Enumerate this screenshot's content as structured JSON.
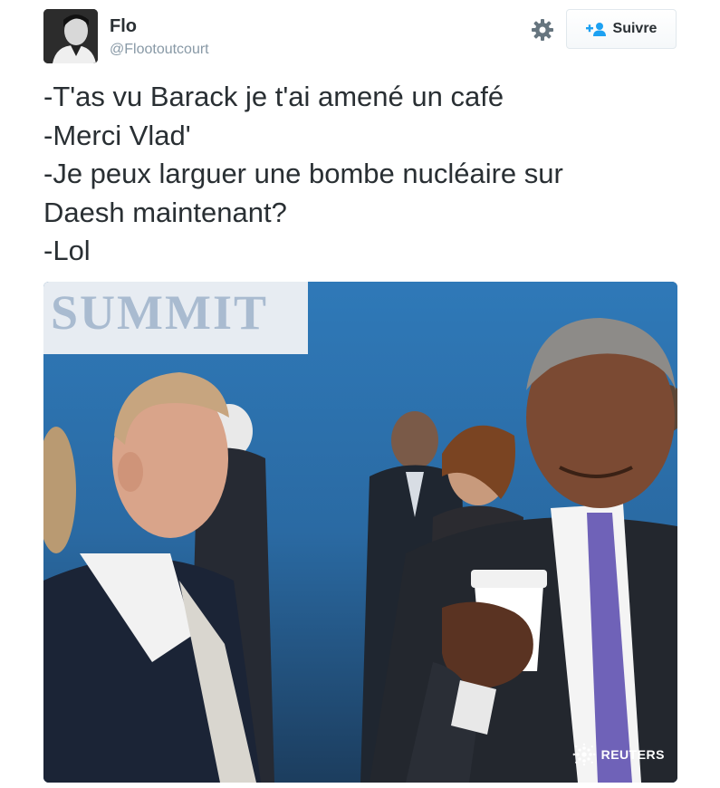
{
  "user": {
    "name": "Flo",
    "handle": "@Flootoutcourt"
  },
  "actions": {
    "follow_label": "Suivre",
    "settings_icon": "gear-icon",
    "follow_icon": "add-user-icon"
  },
  "tweet": {
    "lines": [
      "-T'as vu Barack je t'ai amené un café",
      "-Merci Vlad'",
      "-Je peux larguer une bombe nucléaire sur",
      "Daesh maintenant?",
      "-Lol"
    ]
  },
  "media": {
    "banner_text": "SUMMIT",
    "credit": "REUTERS"
  },
  "colors": {
    "text": "#292f33",
    "secondary": "#8899a6",
    "accent": "#1da1f2"
  }
}
